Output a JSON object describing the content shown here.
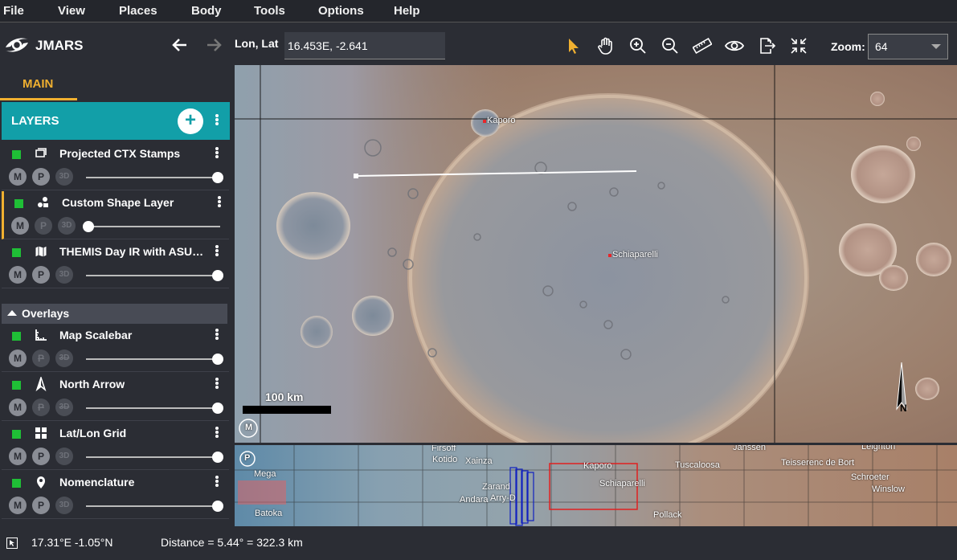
{
  "menu": [
    "File",
    "View",
    "Places",
    "Body",
    "Tools",
    "Options",
    "Help"
  ],
  "app": {
    "title": "JMARS"
  },
  "toolbar": {
    "lonlat_label": "Lon, Lat",
    "lonlat_value": "16.453E, -2.641",
    "zoom_label": "Zoom:",
    "zoom_value": "64",
    "tools": [
      "select-arrow-icon",
      "pan-hand-icon",
      "zoom-in-icon",
      "zoom-out-icon",
      "ruler-icon",
      "eye-icon",
      "export-icon",
      "collapse-icon"
    ]
  },
  "sidebar": {
    "tab": "MAIN",
    "layers_title": "LAYERS",
    "layers": [
      {
        "name": "Projected CTX Stamps",
        "icon": "stamps-icon",
        "m": true,
        "p": true,
        "d3": false,
        "opacity": 1.0,
        "active": false
      },
      {
        "name": "Custom Shape Layer",
        "icon": "shapes-icon",
        "m": true,
        "p": false,
        "d3": false,
        "opacity": 0.0,
        "active": true
      },
      {
        "name": "THEMIS Day IR with ASU ...",
        "icon": "map-icon",
        "m": true,
        "p": true,
        "d3": false,
        "opacity": 1.0,
        "active": false
      }
    ],
    "overlays_title": "Overlays",
    "overlays": [
      {
        "name": "Map Scalebar",
        "icon": "scalebar-icon",
        "m": true,
        "p": false,
        "d3": false,
        "opacity": 1.0
      },
      {
        "name": "North Arrow",
        "icon": "north-arrow-icon",
        "m": true,
        "p": false,
        "d3": false,
        "opacity": 1.0
      },
      {
        "name": "Lat/Lon Grid",
        "icon": "grid-icon",
        "m": true,
        "p": true,
        "d3": false,
        "opacity": 1.0
      },
      {
        "name": "Nomenclature",
        "icon": "pin-icon",
        "m": true,
        "p": true,
        "d3": false,
        "opacity": 1.0
      }
    ],
    "mode_labels": {
      "m": "M",
      "p": "P",
      "d3": "3D"
    }
  },
  "map": {
    "labels": [
      "Kaporo",
      "Schiaparelli"
    ],
    "scalebar_label": "100 km",
    "north_label": "N",
    "badge": "M"
  },
  "panner": {
    "badge": "P",
    "labels": [
      "Firsoff",
      "Kotido",
      "Xainza",
      "Kaporo",
      "Schiaparelli",
      "Tuscaloosa",
      "Janssen",
      "Teisserenc de Bort",
      "Leighton",
      "Schroeter",
      "Winslow",
      "Pollack",
      "Batoka",
      "Andara",
      "Arry-D",
      "Zarand",
      "Mega"
    ]
  },
  "status": {
    "coords": "17.31°E  -1.05°N",
    "distance": "Distance = 5.44° = 322.3 km"
  },
  "colors": {
    "accent": "#f0b030",
    "layers_header": "#129fa8",
    "check": "#1fbf36"
  }
}
